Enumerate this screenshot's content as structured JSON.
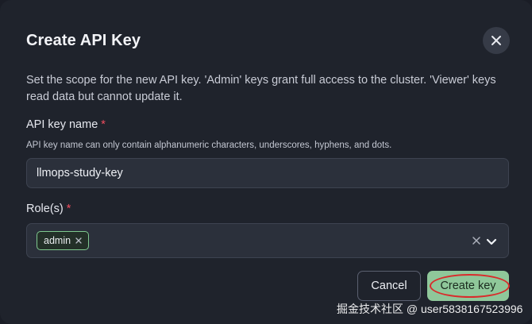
{
  "dialog": {
    "title": "Create API Key",
    "description": "Set the scope for the new API key. 'Admin' keys grant full access to the cluster. 'Viewer' keys read data but cannot update it."
  },
  "name_field": {
    "label": "API key name",
    "required_marker": "*",
    "hint": "API key name can only contain alphanumeric characters, underscores, hyphens, and dots.",
    "value": "llmops-study-key"
  },
  "roles_field": {
    "label": "Role(s)",
    "required_marker": "*",
    "selected": [
      "admin"
    ]
  },
  "actions": {
    "cancel_label": "Cancel",
    "create_label": "Create key"
  },
  "watermark": {
    "text": "掘金技术社区 @ user5838167523996"
  },
  "colors": {
    "background": "#1f232c",
    "required": "#ef4d5e",
    "primary_button": "#8fc79a",
    "chip_border": "#7fc98f",
    "annotation": "#d92b2b"
  },
  "icons": {
    "close": "close-icon",
    "chip_remove": "x-icon",
    "clear": "clear-icon",
    "expand": "chevron-down-icon"
  }
}
